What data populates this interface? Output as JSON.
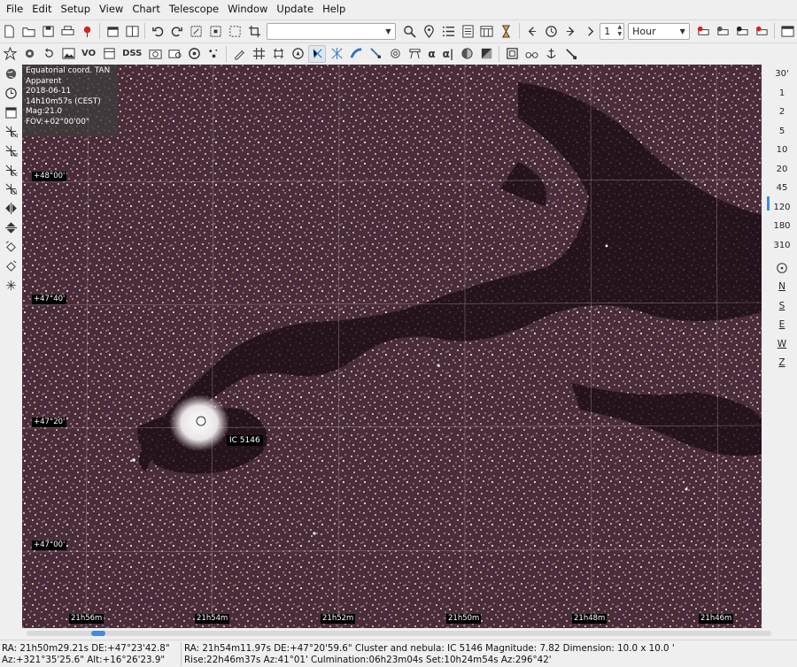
{
  "menu": [
    "File",
    "Edit",
    "Setup",
    "View",
    "Chart",
    "Telescope",
    "Window",
    "Update",
    "Help"
  ],
  "toolbar": {
    "search_value": "",
    "step_value": "1",
    "time_unit": "Hour",
    "dss_label": "DSS",
    "vo_label": "VO",
    "alpha_label": "α",
    "alpha_pipe_label": "α|"
  },
  "right_panel": {
    "fov_buttons": [
      "30'",
      "1",
      "2",
      "5",
      "10",
      "20",
      "45",
      "120",
      "180",
      "310"
    ],
    "direction_buttons": [
      "N",
      "S",
      "E",
      "W",
      "Z"
    ]
  },
  "infobox": {
    "lines": [
      "Equatorial coord. TAN",
      "Apparent",
      "2018-06-11",
      "14h10m57s (CEST)",
      "Mag:21.0",
      "FOV:+02°00'00\""
    ]
  },
  "map": {
    "dec_labels": [
      "+48°00'",
      "+47°40'",
      "+47°20'",
      "+47°00'"
    ],
    "ra_labels": [
      "21h56m",
      "21h54m",
      "21h52m",
      "21h50m",
      "21h48m",
      "21h46m"
    ],
    "object_label": "IC 5146",
    "colors": {
      "sky": "#3a2330",
      "star_warm": "#e9c9a0",
      "dust": "#1a0b14",
      "grid": "#b9a4a8"
    }
  },
  "status": {
    "cursor_radec": "RA: 21h50m29.21s DE:+47°23'42.8\"",
    "cursor_azalt": "Az:+321°35'25.6\" Alt:+16°26'23.9\"",
    "object_line1": "RA: 21h54m11.97s DE:+47°20'59.6\"  Cluster and nebula: IC 5146  Magnitude:  7.82  Dimension:  10.0 x 10.0 '",
    "object_line2": "Rise:22h46m37s Az:41°01'  Culmination:06h23m04s  Set:10h24m54s Az:296°42'"
  }
}
